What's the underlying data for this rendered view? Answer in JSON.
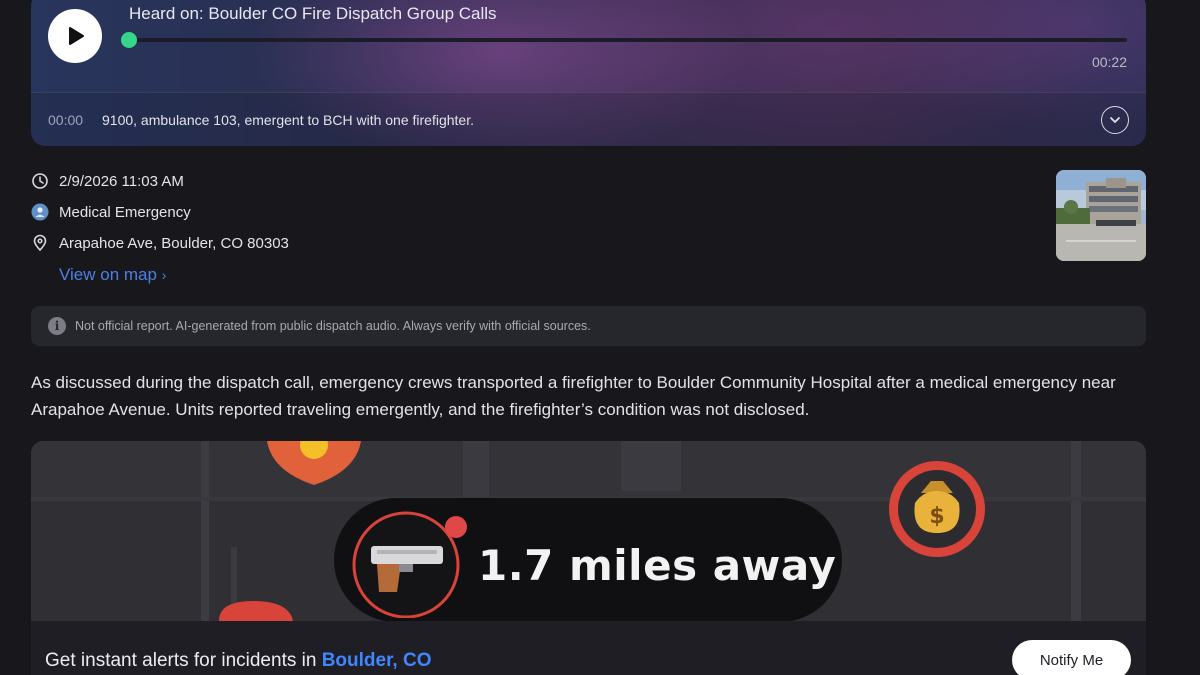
{
  "player": {
    "heard_on": "Heard on: Boulder CO Fire Dispatch Group Calls",
    "duration": "00:22",
    "progress": 0,
    "transcript_time": "00:00",
    "transcript_text": "9100, ambulance 103, emergent to BCH with one firefighter.",
    "accent_color": "#35d58a"
  },
  "incident": {
    "datetime": "2/9/2026 11:03 AM",
    "category": "Medical Emergency",
    "address": "Arapahoe Ave, Boulder, CO 80303",
    "map_link": "View on map",
    "map_link_chevron": "›"
  },
  "disclaimer": {
    "icon": "i",
    "text": "Not official report. AI-generated from public dispatch audio. Always verify with official sources."
  },
  "summary": "As discussed during the dispatch call, emergency crews transported a firefighter to Boulder Community Hospital after a medical emergency near Arapahoe Avenue. Units reported traveling emergently, and the firefighter’s condition was not disclosed.",
  "promo": {
    "distance": "1.7 miles away",
    "alert_prefix": "Get instant alerts for incidents in ",
    "city": "Boulder, CO",
    "notify_label": "Notify Me",
    "city_color": "#3f86ff"
  },
  "icons": {
    "play": "play-icon",
    "expand": "chevron-down-icon",
    "clock": "clock-icon",
    "category": "medical-person-icon",
    "location": "location-pin-icon",
    "info": "info-icon",
    "gun": "handgun-icon",
    "money": "money-bag-icon"
  }
}
